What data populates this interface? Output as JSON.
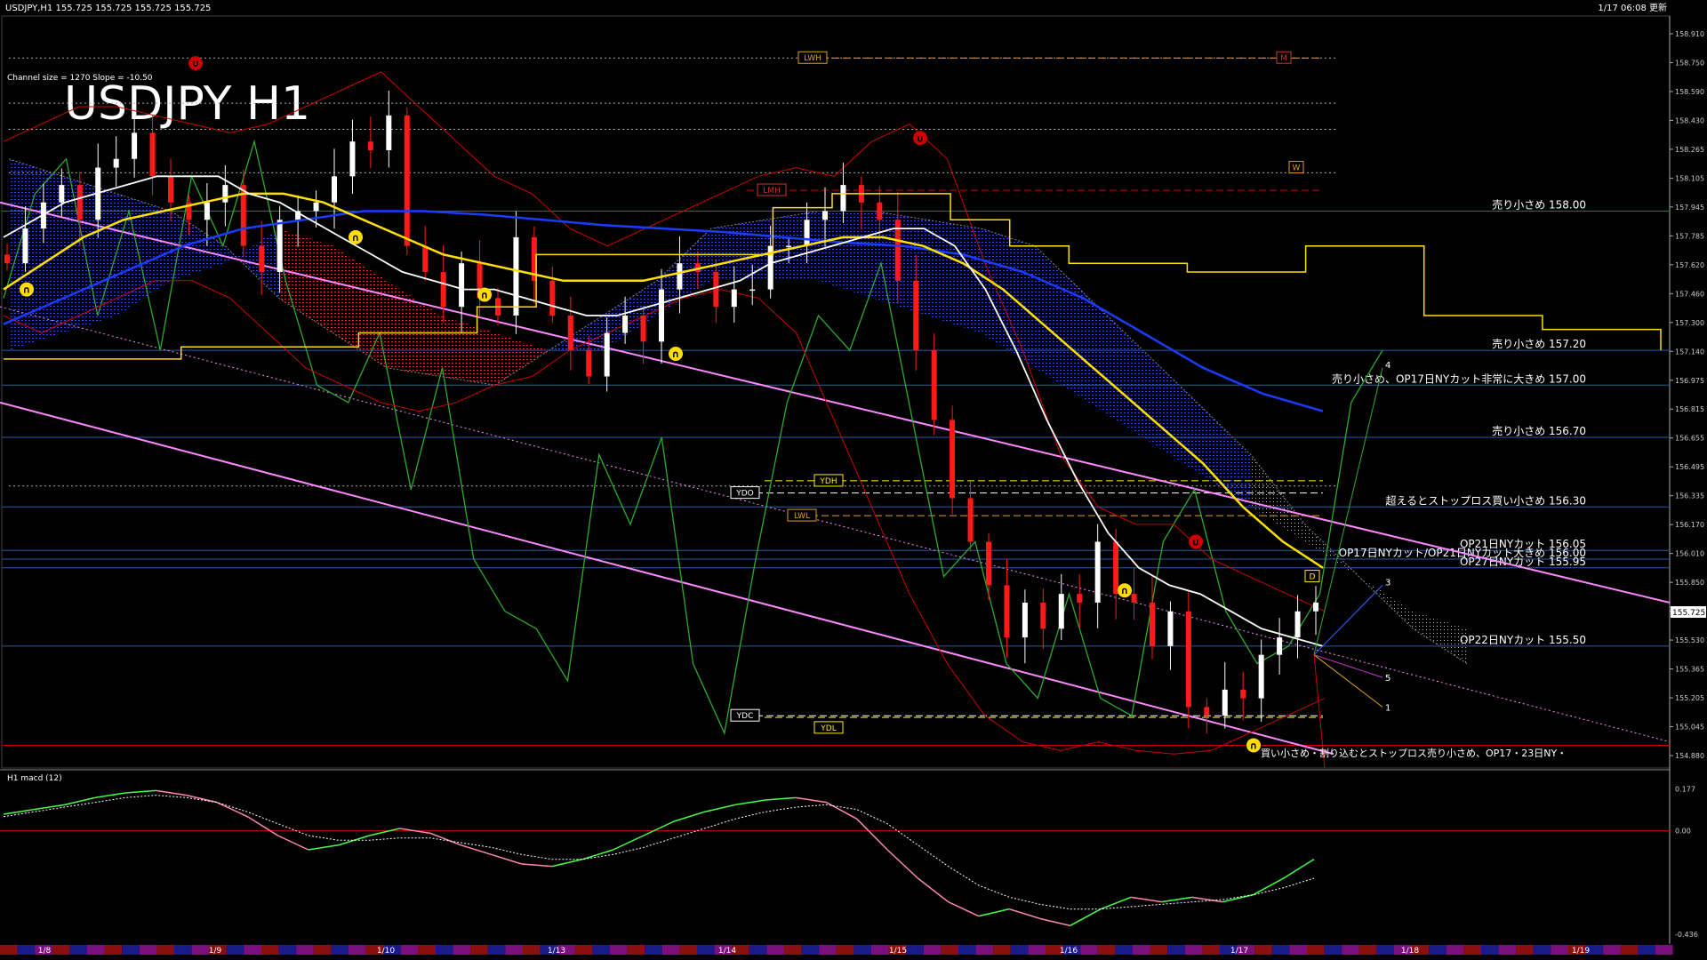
{
  "header": {
    "symbol_line": "USDJPY,H1  155.725 155.725 155.725 155.725",
    "time_updated": "1/17 06:08 更新",
    "channel_info": "Channel size = 1270 Slope = -10.50",
    "big_title": "USDJPY H1"
  },
  "colors": {
    "background": "#000000",
    "bull_candle": "#ffffff",
    "bear_candle": "#ff1a1a",
    "sma_fast": "#ffffff",
    "sma_mid": "#ffe000",
    "sma_slow": "#1a3cff",
    "bollinger": "#cc0000",
    "cloud_blue": "#3355ff",
    "cloud_red": "#ff3333",
    "rsi_line": "#2eaa2e",
    "channel": "#ff88ff",
    "level_line": "#2a5aa8",
    "macd_main": "#44ff44",
    "macd_main_down": "#ff88aa",
    "macd_signal": "#ffffff"
  },
  "chart_data": {
    "type": "line",
    "title": "USDJPY H1",
    "x_ticks": [
      "1/8",
      "1/9",
      "1/10",
      "1/13",
      "1/14",
      "1/15",
      "1/16",
      "1/17",
      "1/18",
      "1/19"
    ],
    "price_axis_ticks": [
      "158.910",
      "158.750",
      "158.590",
      "158.430",
      "158.265",
      "158.105",
      "157.945",
      "157.785",
      "157.620",
      "157.460",
      "157.300",
      "157.140",
      "156.975",
      "156.815",
      "156.655",
      "156.495",
      "156.335",
      "156.170",
      "156.010",
      "155.850",
      "155.690",
      "155.530",
      "155.365",
      "155.205",
      "155.045",
      "154.880"
    ],
    "ylim": [
      154.82,
      159.06
    ],
    "current_price": "155.725",
    "close_path": [
      157.7,
      157.9,
      158.05,
      158.15,
      157.95,
      158.25,
      158.3,
      158.45,
      158.2,
      158.05,
      157.95,
      158.05,
      158.15,
      157.8,
      157.65,
      157.95,
      158.0,
      158.05,
      158.2,
      158.4,
      158.35,
      158.55,
      157.8,
      157.65,
      157.45,
      157.7,
      157.5,
      157.4,
      157.85,
      157.6,
      157.4,
      157.2,
      157.05,
      157.3,
      157.4,
      157.25,
      157.55,
      157.7,
      157.65,
      157.45,
      157.55,
      157.55,
      157.8,
      157.8,
      157.95,
      158.0,
      158.15,
      158.05,
      157.95,
      157.6,
      157.2,
      156.8,
      156.35,
      156.1,
      155.85,
      155.55,
      155.75,
      155.6,
      155.8,
      155.75,
      156.1,
      155.8,
      155.75,
      155.5,
      155.7,
      155.15,
      155.1,
      155.25,
      155.2,
      155.45,
      155.55,
      155.7,
      155.75
    ],
    "sma_fast": [
      157.85,
      157.95,
      158.05,
      158.1,
      158.15,
      158.2,
      158.2,
      158.2,
      158.1,
      158.05,
      157.95,
      157.85,
      157.75,
      157.65,
      157.6,
      157.55,
      157.55,
      157.5,
      157.45,
      157.4,
      157.4,
      157.45,
      157.5,
      157.55,
      157.6,
      157.7,
      157.75,
      157.8,
      157.85,
      157.9,
      157.9,
      157.8,
      157.55,
      157.2,
      156.8,
      156.45,
      156.15,
      155.95,
      155.85,
      155.8,
      155.7,
      155.6,
      155.55,
      155.5
    ],
    "sma_mid": [
      157.55,
      157.7,
      157.85,
      157.95,
      158.0,
      158.05,
      158.1,
      158.1,
      158.05,
      157.95,
      157.85,
      157.75,
      157.7,
      157.65,
      157.6,
      157.6,
      157.6,
      157.65,
      157.7,
      157.75,
      157.8,
      157.85,
      157.85,
      157.8,
      157.7,
      157.55,
      157.35,
      157.15,
      156.95,
      156.75,
      156.55,
      156.3,
      156.1,
      155.95
    ],
    "sma_slow": [
      157.35,
      157.5,
      157.65,
      157.8,
      157.9,
      157.95,
      158.0,
      158.0,
      157.98,
      157.95,
      157.92,
      157.9,
      157.88,
      157.85,
      157.82,
      157.8,
      157.75,
      157.65,
      157.5,
      157.3,
      157.1,
      156.95,
      156.85
    ],
    "levels": [
      {
        "price": 158.0,
        "label": "売り小さめ 158.00"
      },
      {
        "price": 157.2,
        "label": "売り小さめ 157.20"
      },
      {
        "price": 157.0,
        "label": "売り小さめ、OP17日NYカット非常に大きめ 157.00"
      },
      {
        "price": 156.7,
        "label": "売り小さめ 156.70"
      },
      {
        "price": 156.3,
        "label": "超えるとストップロス買い小さめ 156.30"
      },
      {
        "price": 156.05,
        "label": "OP21日NYカット 156.05"
      },
      {
        "price": 156.0,
        "label": "OP17日NYカット/OP21日NYカット大きめ 156.00"
      },
      {
        "price": 155.95,
        "label": "OP27日NYカット 155.95"
      },
      {
        "price": 155.5,
        "label": "OP22日NYカット 155.50"
      }
    ],
    "bottom_note": "買い小さめ・割り込むとストップロス売り小さめ、OP17・23日NY・",
    "tags": [
      "LWH",
      "LMH",
      "YDH",
      "YDO",
      "LWL",
      "YDC",
      "YDL",
      "W",
      "M",
      "D"
    ],
    "projection_labels": [
      "4",
      "3",
      "5",
      "1"
    ],
    "macd": {
      "label": "H1  macd (12)",
      "axis": [
        "0.177",
        "0.00",
        "-0.436"
      ],
      "main": [
        0.07,
        0.09,
        0.11,
        0.14,
        0.16,
        0.17,
        0.15,
        0.12,
        0.06,
        -0.02,
        -0.08,
        -0.06,
        -0.02,
        0.01,
        -0.01,
        -0.06,
        -0.1,
        -0.14,
        -0.15,
        -0.12,
        -0.08,
        -0.02,
        0.04,
        0.08,
        0.11,
        0.13,
        0.14,
        0.12,
        0.05,
        -0.08,
        -0.2,
        -0.3,
        -0.36,
        -0.33,
        -0.37,
        -0.4,
        -0.33,
        -0.28,
        -0.3,
        -0.28,
        -0.3,
        -0.27,
        -0.2,
        -0.12
      ],
      "signal": [
        0.06,
        0.08,
        0.1,
        0.12,
        0.14,
        0.15,
        0.14,
        0.12,
        0.08,
        0.03,
        -0.02,
        -0.04,
        -0.04,
        -0.03,
        -0.03,
        -0.05,
        -0.07,
        -0.1,
        -0.12,
        -0.12,
        -0.1,
        -0.07,
        -0.03,
        0.01,
        0.05,
        0.08,
        0.1,
        0.11,
        0.09,
        0.03,
        -0.06,
        -0.15,
        -0.23,
        -0.28,
        -0.31,
        -0.33,
        -0.33,
        -0.32,
        -0.31,
        -0.3,
        -0.29,
        -0.27,
        -0.24,
        -0.2
      ]
    }
  }
}
